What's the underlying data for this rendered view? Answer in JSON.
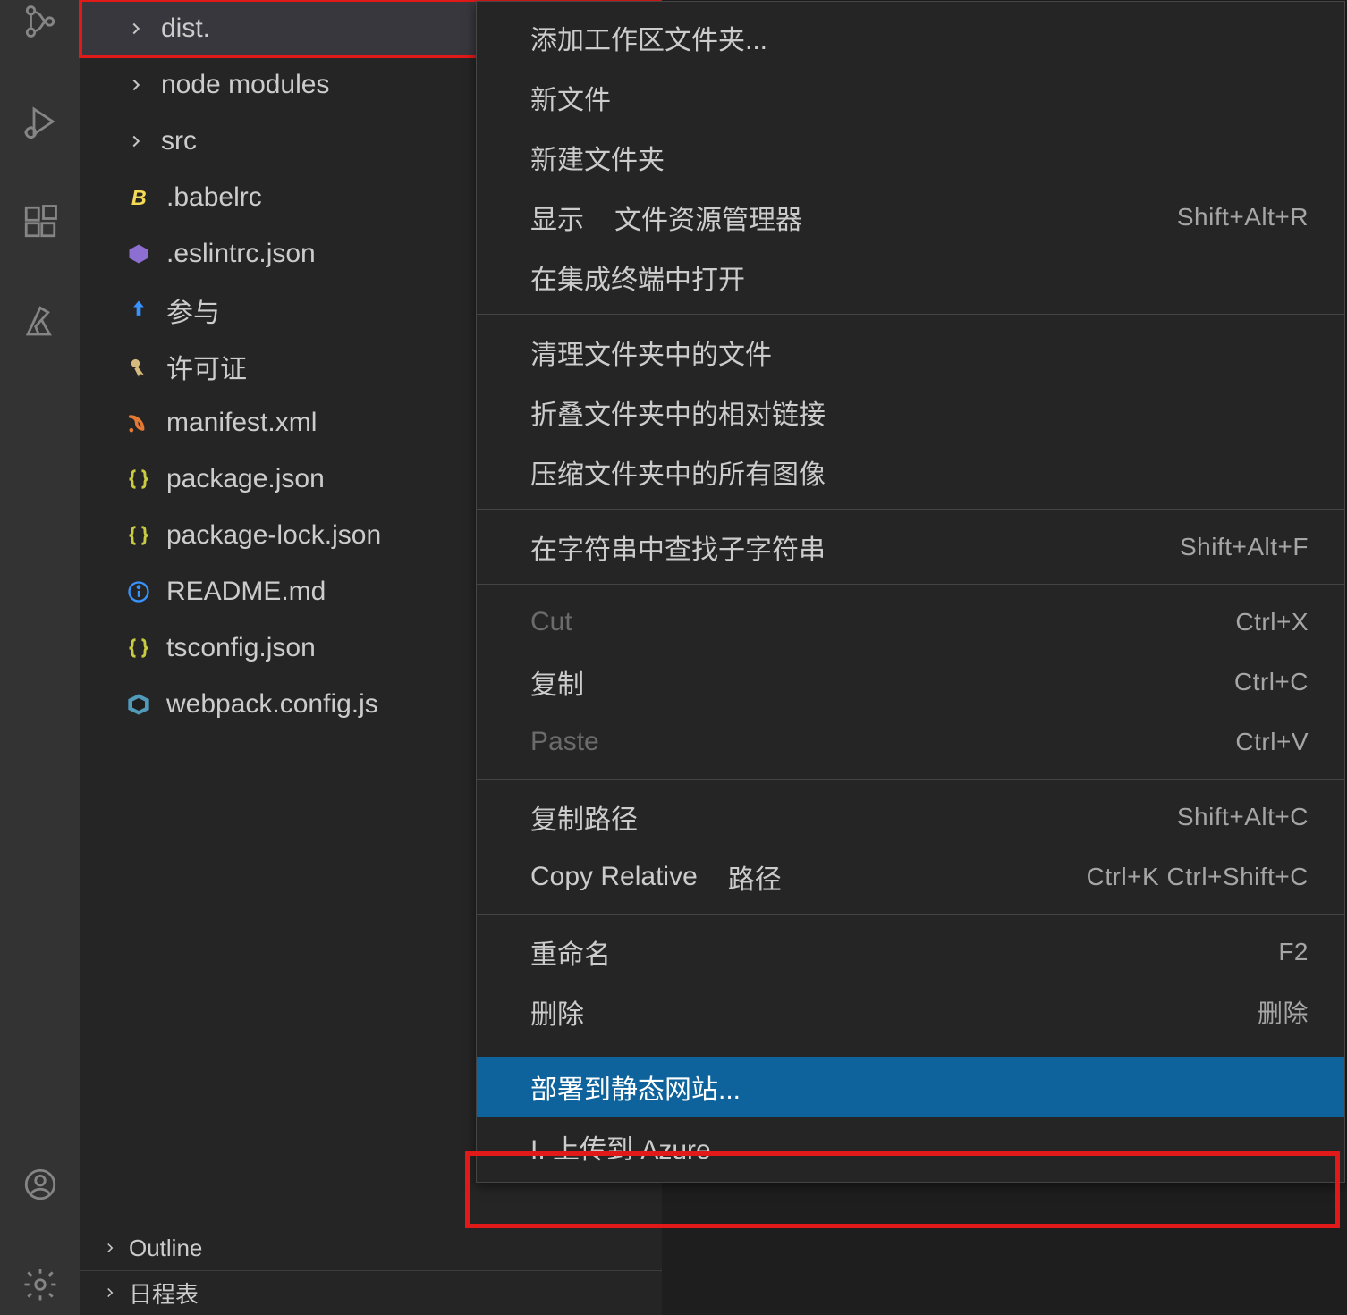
{
  "activity": {
    "source_control": "source-control",
    "run_debug": "run-and-debug",
    "extensions": "extensions",
    "azure": "azure",
    "account": "account",
    "settings": "settings-gear"
  },
  "tree": {
    "items": [
      {
        "type": "folder",
        "label": "dist.",
        "name": "folder-dist",
        "selected": true
      },
      {
        "type": "folder",
        "label": "node modules",
        "name": "folder-node-modules"
      },
      {
        "type": "folder",
        "label": "src",
        "name": "folder-src"
      },
      {
        "type": "file",
        "label": ".babelrc",
        "icon": "babel",
        "name": "file-babelrc"
      },
      {
        "type": "file",
        "label": ".eslintrc.json",
        "icon": "eslint",
        "name": "file-eslintrc"
      },
      {
        "type": "file",
        "label": "参与",
        "icon": "contrib",
        "name": "file-contrib"
      },
      {
        "type": "file",
        "label": "许可证",
        "icon": "license",
        "name": "file-license"
      },
      {
        "type": "file",
        "label": "manifest.xml",
        "icon": "xml",
        "name": "file-manifest"
      },
      {
        "type": "file",
        "label": "package.json",
        "icon": "json",
        "name": "file-package-json"
      },
      {
        "type": "file",
        "label": "package-lock.json",
        "icon": "json",
        "name": "file-package-lock-json"
      },
      {
        "type": "file",
        "label": "README.md",
        "icon": "info",
        "name": "file-readme"
      },
      {
        "type": "file",
        "label": "tsconfig.json",
        "icon": "json",
        "name": "file-tsconfig"
      },
      {
        "type": "file",
        "label": "webpack.config.js",
        "icon": "webpack",
        "name": "file-webpack-config"
      }
    ]
  },
  "panels": {
    "outline": "Outline",
    "schedule": "日程表"
  },
  "menu": {
    "items": [
      {
        "label": "添加工作区文件夹...",
        "name": "menu-add-workspace-folder"
      },
      {
        "label": "新文件",
        "name": "menu-new-file"
      },
      {
        "label": "新建文件夹",
        "name": "menu-new-folder"
      },
      {
        "label": "显示",
        "sublabel": "文件资源管理器",
        "shortcut": "Shift+Alt+R",
        "name": "menu-reveal-explorer"
      },
      {
        "label": "在集成终端中打开",
        "name": "menu-open-terminal"
      },
      {
        "sep": true
      },
      {
        "label": "清理文件夹中的文件",
        "name": "menu-cleanup-files"
      },
      {
        "label": "折叠文件夹中的相对链接",
        "name": "menu-collapse-links"
      },
      {
        "label": "压缩文件夹中的所有图像",
        "name": "menu-compress-images"
      },
      {
        "sep": true
      },
      {
        "label": "在字符串中查找子字符串",
        "shortcut": "Shift+Alt+F",
        "name": "menu-find-in-folder"
      },
      {
        "sep": true
      },
      {
        "label": "Cut",
        "shortcut": "Ctrl+X",
        "disabled": true,
        "name": "menu-cut"
      },
      {
        "label": "复制",
        "shortcut": "Ctrl+C",
        "name": "menu-copy"
      },
      {
        "label": "Paste",
        "shortcut": "Ctrl+V",
        "disabled": true,
        "name": "menu-paste"
      },
      {
        "sep": true
      },
      {
        "label": "复制路径",
        "shortcut": "Shift+Alt+C",
        "name": "menu-copy-path"
      },
      {
        "label": "Copy Relative",
        "sublabel": "路径",
        "shortcut": "Ctrl+K Ctrl+Shift+C",
        "name": "menu-copy-relative-path"
      },
      {
        "sep": true
      },
      {
        "label": "重命名",
        "shortcut": "F2",
        "name": "menu-rename"
      },
      {
        "label": "删除",
        "shortcut": "删除",
        "name": "menu-delete"
      },
      {
        "sep": true
      },
      {
        "label": "部署到静态网站...",
        "highlight": true,
        "name": "menu-deploy-static-site"
      },
      {
        "label": "I. 上传到 Azure",
        "name": "menu-upload-to-azure"
      }
    ]
  }
}
